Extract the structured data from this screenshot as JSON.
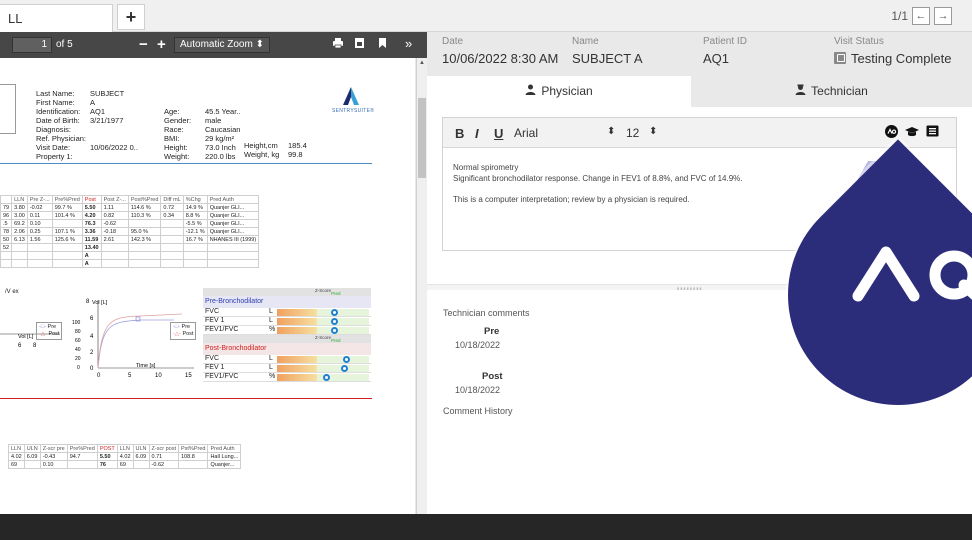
{
  "tabbar": {
    "active_tab": "LL",
    "add_label": "+",
    "pager_text": "1/1",
    "prev_icon": "arrow-left-icon",
    "next_icon": "arrow-right-icon"
  },
  "pdf_toolbar": {
    "page_number": "1",
    "of_pages": "of 5",
    "zoom_out": "−",
    "zoom_in": "+",
    "zoom": "Automatic Zoom",
    "expand": "»"
  },
  "patient_labels": [
    "Last Name:",
    "First Name:",
    "Identification:",
    "Date of Birth:",
    "Diagnosis:",
    "Ref. Physician:",
    "Visit Date:",
    "Property 1:"
  ],
  "patient_values": [
    "SUBJECT",
    "A",
    "AQ1",
    "3/21/1977",
    "",
    "",
    "10/06/2022 0..",
    ""
  ],
  "stats_labels": [
    "Age:",
    "Gender:",
    "Race:",
    "BMI:",
    "Height:",
    "Weight:"
  ],
  "stats_values": [
    "45.5 Year..",
    "male",
    "Caucasian",
    "29 kg/m²",
    "73.0 Inch",
    "220.0 lbs"
  ],
  "height_label": "Height,cm",
  "height_value": "185.4",
  "weight_label": "Weight, kg",
  "weight_value": "99.8",
  "logo_text": "SENTRYSUITE®",
  "results1": {
    "headers": [
      "",
      "LLN",
      "Pre Z-...",
      "Pre%Pred",
      "Post",
      "Post Z-...",
      "Post%Pred",
      "Diff mL",
      "%Chg",
      "Pred Auth"
    ],
    "rows": [
      [
        "79",
        "3.80",
        "-0.02",
        "99.7 %",
        "5.50",
        "1.11",
        "114.6 %",
        "0.72",
        "14.9 %",
        "Quanjer GLI..."
      ],
      [
        "96",
        "3.00",
        "0.11",
        "101.4 %",
        "4.20",
        "0.82",
        "110.3 %",
        "0.34",
        "8.8 %",
        "Quanjer GLI..."
      ],
      [
        ".5",
        "69.2",
        "0.10",
        "",
        "76.3",
        "-0.62",
        "",
        "",
        "-5.5 %",
        "Quanjer GLI..."
      ],
      [
        "78",
        "2.06",
        "0.25",
        "107.1 %",
        "3.36",
        "-0.18",
        "95.0 %",
        "",
        "-12.1 %",
        "Quanjer GLI..."
      ],
      [
        "50",
        "6.13",
        "1.56",
        "125.6 %",
        "11.59",
        "2.61",
        "142.3 %",
        "",
        "16.7 %",
        "NHANES III (1999)"
      ],
      [
        "52",
        "",
        "",
        "",
        "13.40",
        "",
        "",
        "",
        "",
        ""
      ],
      [
        "",
        "",
        "",
        "",
        "A",
        "",
        "",
        "",
        "",
        ""
      ],
      [
        "",
        "",
        "",
        "",
        "A",
        "",
        "",
        "",
        "",
        ""
      ]
    ]
  },
  "plots": {
    "fv_label": "/V ex",
    "vol_label": "Vol [L]",
    "time_label": "Time [s]",
    "legend_pre": "Pre",
    "legend_post": "Post",
    "fv_x_ticks": [
      "6",
      "8"
    ],
    "vt_y_ticks": [
      "8",
      "6",
      "4",
      "2",
      "0"
    ],
    "vt_y_ticks2": [
      "100",
      "80",
      "60",
      "40",
      "20",
      "0"
    ],
    "vt_x_ticks": [
      "0",
      "5",
      "10",
      "15"
    ]
  },
  "zscore": {
    "title": "Z-Score",
    "pred_label": "Pred",
    "pre_title": "Pre-Bronchodilator",
    "post_title": "Post-Bronchodilator",
    "pre_rows": [
      {
        "name": "FVC",
        "unit": "L"
      },
      {
        "name": "FEV 1",
        "unit": "L"
      },
      {
        "name": "FEV1/FVC",
        "unit": "%"
      }
    ],
    "post_rows": [
      {
        "name": "FVC",
        "unit": "L"
      },
      {
        "name": "FEV 1",
        "unit": "L"
      },
      {
        "name": "FEV1/FVC",
        "unit": "%"
      }
    ]
  },
  "results2": {
    "headers": [
      "LLN",
      "ULN",
      "Z-scr pre",
      "Pre%Pred",
      "POST",
      "LLN",
      "ULN",
      "Z-scr post",
      "Pst%Pred",
      "Pred Auth"
    ],
    "rows": [
      [
        "4.02",
        "6.09",
        "-0.43",
        "94.7",
        "5.50",
        "4.02",
        "6.09",
        "0.71",
        "108.8",
        "Hall Lung..."
      ],
      [
        "69",
        "",
        "0.10",
        "",
        "76",
        "69",
        "",
        "-0.62",
        "",
        "Quanjer..."
      ]
    ]
  },
  "visit": {
    "date_label": "Date",
    "date_value": "10/06/2022 8:30 AM",
    "name_label": "Name",
    "name_value": "SUBJECT A",
    "pid_label": "Patient ID",
    "pid_value": "AQ1",
    "status_label": "Visit Status",
    "status_value": "Testing Complete"
  },
  "tabs": {
    "physician": "Physician",
    "technician": "Technician"
  },
  "editor": {
    "bold": "B",
    "italic": "I",
    "underline": "U",
    "font": "Arial",
    "size": "12",
    "lines": [
      "Normal spirometry",
      "Significant bronchodilator response. Change in FEV1 of 8.8%, and FVC of 14.9%.",
      "This is a computer interpretation; review by a physician is required."
    ]
  },
  "technician": {
    "comments_title": "Technician comments",
    "pre_label": "Pre",
    "pre_date": "10/18/2022",
    "post_label": "Post",
    "post_date": "10/18/2022",
    "history_title": "Comment History"
  },
  "colors": {
    "brand": "#2c2d7a",
    "accent_blue": "#3040b0",
    "post_red": "#d02020",
    "toolbar_dark": "#474747"
  }
}
